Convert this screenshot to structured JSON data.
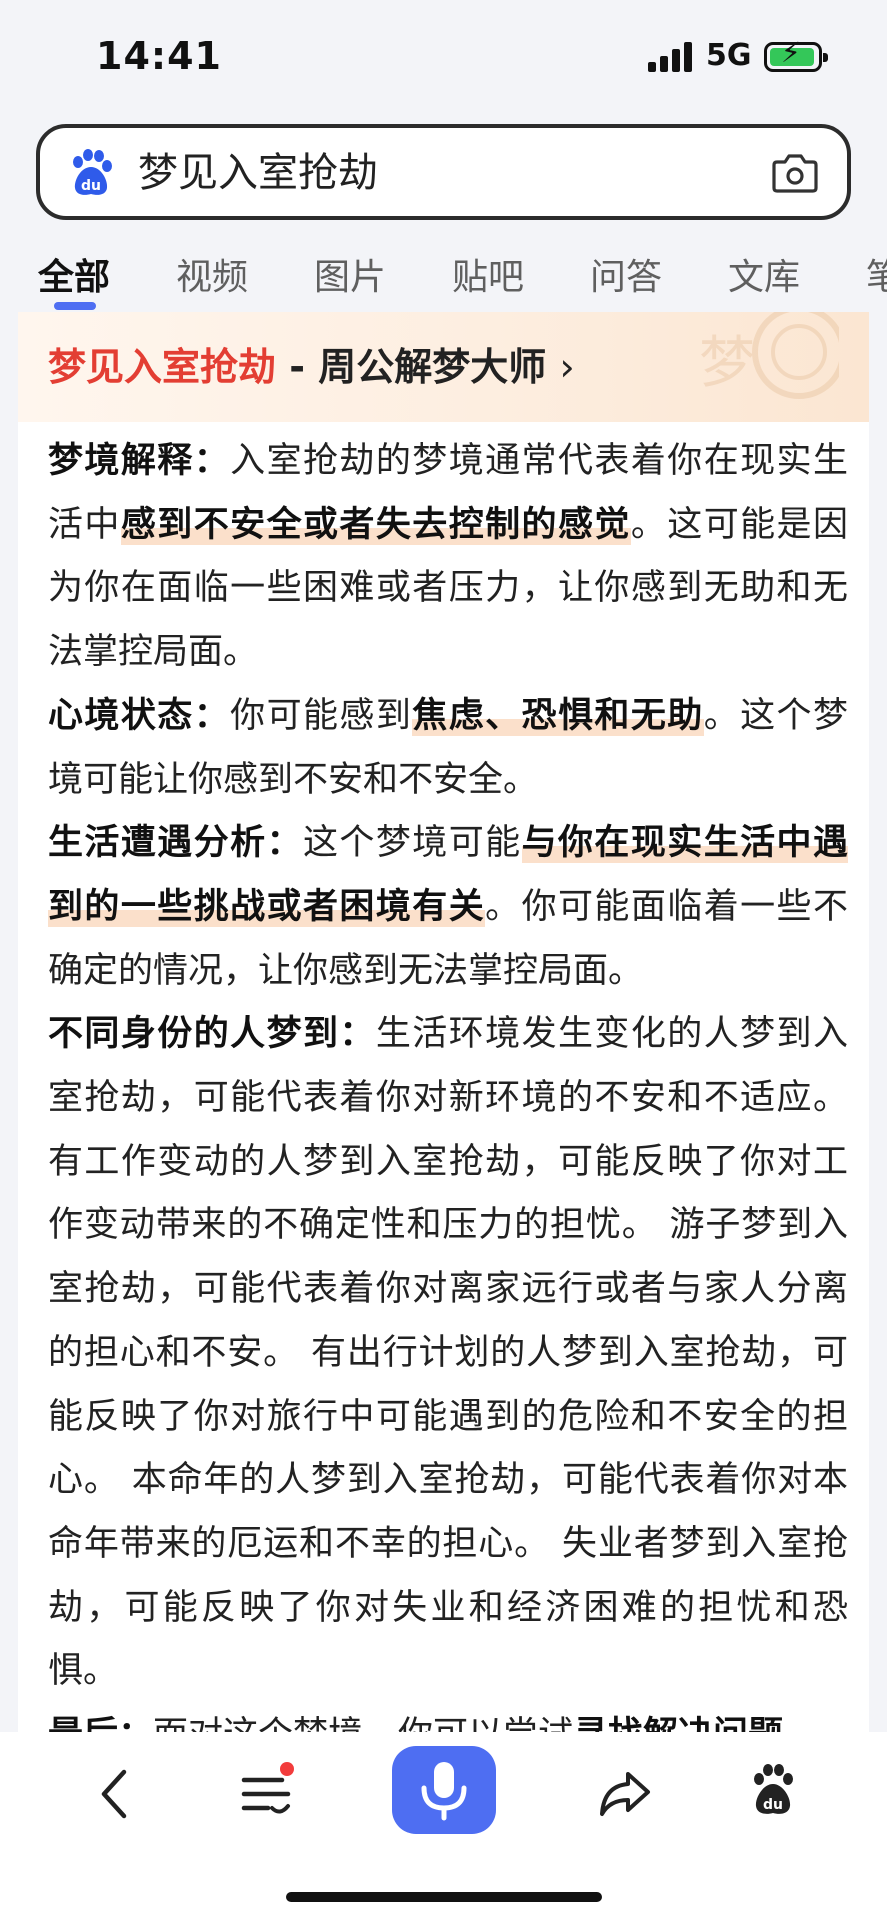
{
  "status_bar": {
    "time": "14:41",
    "network": "5G",
    "battery_charging": true
  },
  "search": {
    "query": "梦见入室抢劫"
  },
  "tabs": [
    {
      "label": "全部",
      "active": true
    },
    {
      "label": "视频",
      "active": false
    },
    {
      "label": "图片",
      "active": false
    },
    {
      "label": "贴吧",
      "active": false
    },
    {
      "label": "问答",
      "active": false
    },
    {
      "label": "文库",
      "active": false
    },
    {
      "label": "笔",
      "active": false
    }
  ],
  "card": {
    "title_keyword": "梦见入室抢劫",
    "title_site": " - 周公解梦大师",
    "chevron": "›",
    "deco_char": "梦",
    "sections": {
      "dream": {
        "heading": "梦境解释：",
        "t1": "入室抢劫的梦境通常代表着你在现实生活中",
        "hl1": "感到不安全或者失去控制的感觉",
        "t2": "。这可能是因为你在面临一些困难或者压力，让你感到无助和无法掌控局面。"
      },
      "mood": {
        "heading": "心境状态：",
        "t1": "你可能感到",
        "hl1": "焦虑、恐惧和无助",
        "t2": "。这个梦境可能让你感到不安和不安全。"
      },
      "life": {
        "heading": "生活遭遇分析：",
        "t1": "这个梦境可能",
        "hl1": "与你在现实生活中遇到的一些挑战或者困境有关",
        "t2": "。你可能面临着一些不确定的情况，让你感到无法掌控局面。"
      },
      "people": {
        "heading": "不同身份的人梦到：",
        "t1": "生活环境发生变化的人梦到入室抢劫，可能代表着你对新环境的不安和不适应。 有工作变动的人梦到入室抢劫，可能反映了你对工作变动带来的不确定性和压力的担忧。 游子梦到入室抢劫，可能代表着你对离家远行或者与家人分离的担心和不安。 有出行计划的人梦到入室抢劫，可能反映了你对旅行中可能遇到的危险和不安全的担心。 本命年的人梦到入室抢劫，可能代表着你对本命年带来的厄运和不幸的担心。 失业者梦到入室抢劫，可能反映了你对失业和经济困难的担忧和恐惧。"
      },
      "final": {
        "heading": "最后：",
        "t1": "面对这个梦境，你可以尝试",
        "hl1": "寻找解决问题"
      }
    }
  },
  "bottom_nav": {
    "has_notification": true
  },
  "colors": {
    "accent": "#4e6ef2",
    "keyword_red": "#e33e33",
    "highlight": "#fbe0cb",
    "notification": "#f23c3c"
  }
}
